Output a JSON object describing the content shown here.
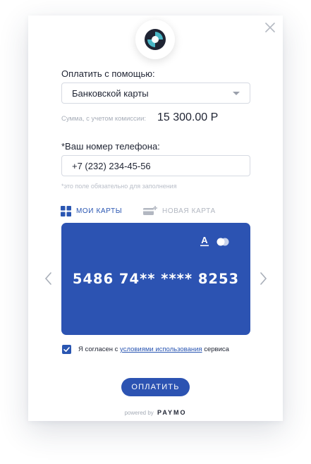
{
  "pay_with": {
    "label": "Оплатить с помощью:",
    "selected": "Банковской карты"
  },
  "amount": {
    "label": "Сумма, с учетом комиссии:",
    "value": "15 300.00 Р"
  },
  "phone": {
    "label": "*Ваш номер телефона:",
    "value": "+7 (232) 234-45-56",
    "hint": "*это поле обязательно для заполнения"
  },
  "tabs": {
    "my_cards": "МОИ КАРТЫ",
    "new_card": "НОВАЯ КАРТА"
  },
  "card": {
    "number": "5486 74** **** 8253",
    "bank_logo": "А",
    "color": "#2c53b2"
  },
  "agreement": {
    "prefix": "Я согласен с ",
    "link": "условиями использования",
    "suffix": " сервиса",
    "checked": true
  },
  "pay_button": "ОПЛАТИТЬ",
  "footer": {
    "powered_by": "powered by",
    "brand": "PAYMO"
  },
  "colors": {
    "accent": "#2a56b2",
    "logo_teal": "#49b6c5",
    "logo_dark": "#1f2433"
  }
}
